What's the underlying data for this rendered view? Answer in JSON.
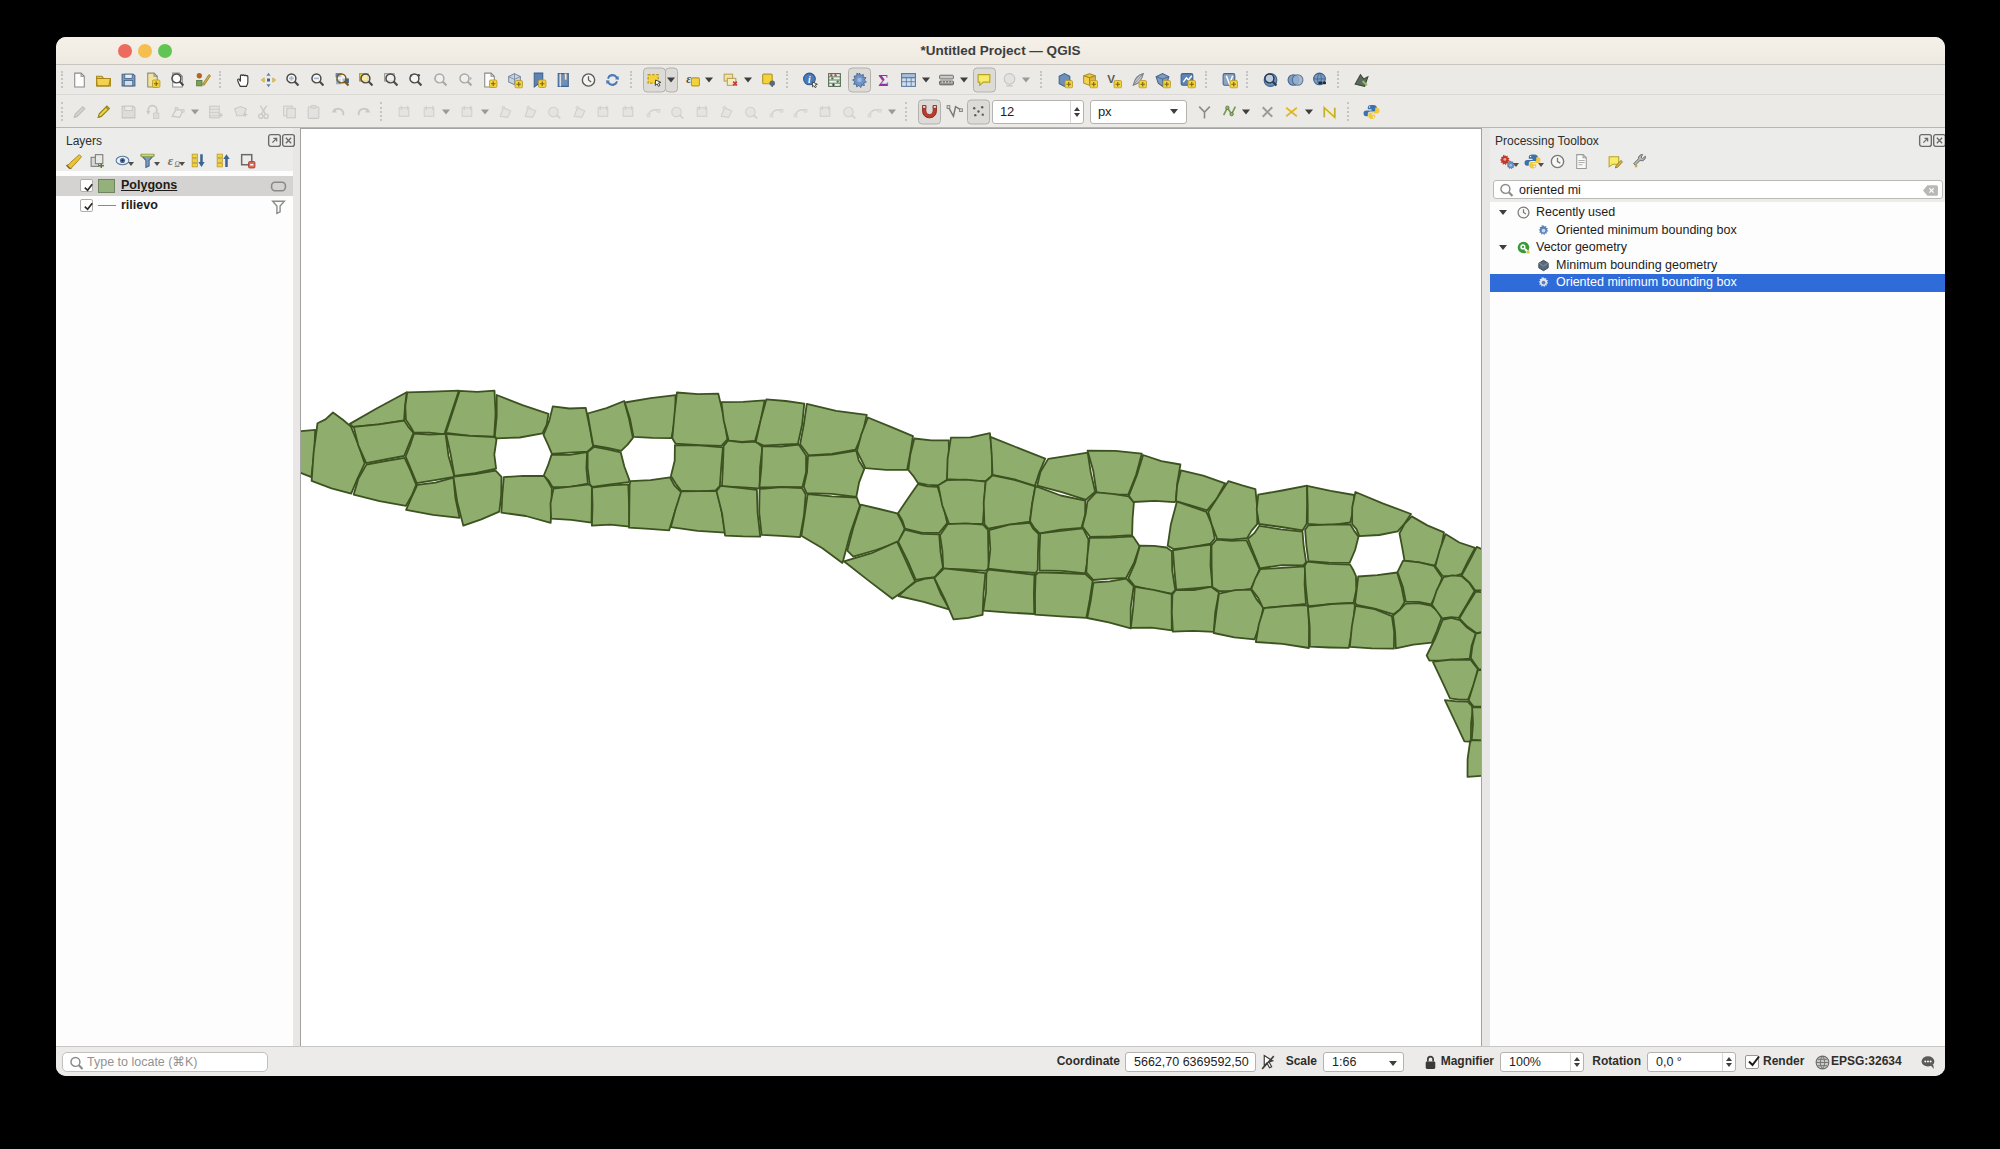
{
  "window": {
    "title": "*Untitled Project — QGIS"
  },
  "traffic_lights": {
    "close": "#ec6a5e",
    "minimize": "#f5bf4f",
    "zoom": "#61c554"
  },
  "toolbar_row1": [
    {
      "icon": "new-project"
    },
    {
      "icon": "open-project"
    },
    {
      "icon": "save-project"
    },
    {
      "icon": "save-as"
    },
    {
      "icon": "layout-manager"
    },
    {
      "icon": "style-manager"
    },
    {
      "sep": 1
    },
    {
      "icon": "pan-map"
    },
    {
      "icon": "pan-selection"
    },
    {
      "icon": "zoom-in"
    },
    {
      "icon": "zoom-out"
    },
    {
      "icon": "zoom-full"
    },
    {
      "icon": "zoom-selection"
    },
    {
      "icon": "zoom-layer"
    },
    {
      "icon": "zoom-native"
    },
    {
      "icon": "zoom-last",
      "disabled": 1
    },
    {
      "icon": "zoom-next",
      "disabled": 1
    },
    {
      "icon": "new-map-view"
    },
    {
      "icon": "new-3d-view"
    },
    {
      "icon": "new-bookmark"
    },
    {
      "icon": "show-bookmarks"
    },
    {
      "icon": "temporal-clock"
    },
    {
      "icon": "refresh"
    },
    {
      "sep": 1
    },
    {
      "icon": "select-rect",
      "pressed": 1,
      "dd": 1
    },
    {
      "icon": "select-expression",
      "dd": 1
    },
    {
      "icon": "deselect",
      "dd": 1
    },
    {
      "icon": "select-form"
    },
    {
      "sep": 1
    },
    {
      "icon": "identify"
    },
    {
      "icon": "stats-summary"
    },
    {
      "icon": "processing-gear",
      "pressed": 1
    },
    {
      "icon": "sigma"
    },
    {
      "icon": "attr-table",
      "dd": 1
    },
    {
      "icon": "measure",
      "dd": 1
    },
    {
      "icon": "map-tips",
      "pressed": 1
    },
    {
      "icon": "annotation",
      "disabled": 1,
      "dd": 1
    },
    {
      "sep": 1
    },
    {
      "icon": "new-geopackage"
    },
    {
      "icon": "new-shapefile"
    },
    {
      "icon": "new-virtual"
    },
    {
      "icon": "new-memory"
    },
    {
      "icon": "new-mesh"
    },
    {
      "icon": "new-gpx"
    },
    {
      "sep": 1
    },
    {
      "icon": "new-vrt"
    },
    {
      "sep": 1
    },
    {
      "icon": "metasearch"
    },
    {
      "icon": "datasource-manager"
    },
    {
      "icon": "web-services"
    },
    {
      "sep": 1
    },
    {
      "icon": "osm-plugin"
    }
  ],
  "toolbar_row2": [
    {
      "icon": "current-edits",
      "disabled": 1
    },
    {
      "icon": "toggle-editing"
    },
    {
      "icon": "save-edits",
      "disabled": 1
    },
    {
      "icon": "undo-edits",
      "disabled": 1
    },
    {
      "icon": "vertex-tool",
      "disabled": 1,
      "dd": 1
    },
    {
      "icon": "add-record",
      "disabled": 1
    },
    {
      "icon": "add-feature",
      "disabled": 1
    },
    {
      "icon": "cut-features",
      "disabled": 1
    },
    {
      "icon": "copy-features",
      "disabled": 1
    },
    {
      "icon": "paste-features",
      "disabled": 1
    },
    {
      "icon": "undo",
      "disabled": 1
    },
    {
      "icon": "redo",
      "disabled": 1
    },
    {
      "sep": 1
    },
    {
      "icon": "dig-chart",
      "disabled": 1
    },
    {
      "icon": "dig-line",
      "disabled": 1,
      "dd": 1
    },
    {
      "icon": "dig-circle",
      "disabled": 1,
      "dd": 1
    },
    {
      "icon": "dig-move",
      "disabled": 1
    },
    {
      "icon": "dig-copy",
      "disabled": 1
    },
    {
      "icon": "dig-rotate",
      "disabled": 1
    },
    {
      "icon": "dig-simplify",
      "disabled": 1
    },
    {
      "icon": "dig-add-ring",
      "disabled": 1
    },
    {
      "icon": "dig-fill-ring",
      "disabled": 1
    },
    {
      "icon": "dig-del-ring",
      "disabled": 1
    },
    {
      "icon": "dig-offset",
      "disabled": 1
    },
    {
      "icon": "dig-reshape",
      "disabled": 1
    },
    {
      "icon": "dig-split-feat",
      "disabled": 1
    },
    {
      "icon": "dig-split-parts",
      "disabled": 1
    },
    {
      "icon": "dig-merge",
      "disabled": 1
    },
    {
      "icon": "dig-merge-attr",
      "disabled": 1
    },
    {
      "icon": "dig-rotate-pt",
      "disabled": 1
    },
    {
      "icon": "dig-align",
      "disabled": 1
    },
    {
      "icon": "dig-trim",
      "disabled": 1,
      "dd": 1
    },
    {
      "sep": 1
    },
    {
      "icon": "snapping-magnet",
      "pressed": 1
    },
    {
      "icon": "topo-editing"
    },
    {
      "icon": "snap-intersection",
      "pressed": 1
    },
    {
      "type": "spin",
      "value": "12",
      "w": 92
    },
    {
      "type": "combo",
      "value": "px",
      "w": 97
    },
    {
      "icon": "tracing-y"
    },
    {
      "icon": "tracing-enable",
      "dd": 1
    },
    {
      "icon": "clear-x"
    },
    {
      "icon": "snap-yellow-x",
      "dd": 1
    },
    {
      "icon": "tracing-n"
    },
    {
      "sep": 1
    },
    {
      "icon": "python-console"
    }
  ],
  "layers_panel": {
    "title": "Layers",
    "toolbar": [
      {
        "icon": "style-brush"
      },
      {
        "icon": "add-group"
      },
      {
        "icon": "manage-themes",
        "dd": 1
      },
      {
        "icon": "filter-legend",
        "dd": 1
      },
      {
        "icon": "filter-expression",
        "dd": 1
      },
      {
        "icon": "expand-all"
      },
      {
        "icon": "collapse-all"
      },
      {
        "icon": "remove-layer"
      }
    ],
    "layers": [
      {
        "name": "Polygons",
        "checked": true,
        "selected": true,
        "active": true,
        "swatch": "#94b17c",
        "badge": "badge-map"
      },
      {
        "name": "rilievo",
        "checked": true,
        "symbol": "line",
        "badge": "badge-filter"
      }
    ]
  },
  "processing_panel": {
    "title": "Processing Toolbox",
    "toolbar": [
      {
        "icon": "proc-algs",
        "dd2": 1
      },
      {
        "icon": "python-console",
        "dd2": 1
      },
      {
        "icon": "history-clock"
      },
      {
        "icon": "log-doc"
      },
      {
        "sep": 1
      },
      {
        "icon": "edit-inplace"
      },
      {
        "icon": "wrench"
      }
    ],
    "search": {
      "value": "oriented mi"
    },
    "tree": [
      {
        "level": 0,
        "icon": "history-clock",
        "label": "Recently used",
        "expanded": true
      },
      {
        "level": 1,
        "icon": "algorithm",
        "label": "Oriented minimum bounding box"
      },
      {
        "level": 0,
        "icon": "qgis-logo",
        "label": "Vector geometry",
        "expanded": true
      },
      {
        "level": 1,
        "icon": "min-bounding",
        "label": "Minimum bounding geometry"
      },
      {
        "level": 1,
        "icon": "algorithm",
        "label": "Oriented minimum bounding box",
        "selected": true
      }
    ]
  },
  "statusbar": {
    "locate_placeholder": "Type to locate (⌘K)",
    "coordinate_label": "Coordinate",
    "coordinate_value": "5662,70 6369592,50",
    "scale_label": "Scale",
    "scale_value": "1:66",
    "magnifier_label": "Magnifier",
    "magnifier_value": "100%",
    "rotation_label": "Rotation",
    "rotation_value": "0,0 °",
    "render_label": "Render",
    "crs_label": "EPSG:32634"
  },
  "map": {
    "background": "#ffffff",
    "fill": "#8fad6c",
    "stroke": "#3c5220",
    "polygons": [
      "M267.6,457.7L271.2,445.2L273.2,432.0L294.1,430.7L314.2,428.9L313.3,452.2L310.4,476.1L289.0,467.5Z",
      "M332.0,411.5L341.9,418.7L350.0,425.6L357.5,444.1L363.7,462.4L356.6,477.4L350.2,492.7L330.5,487.4L310.6,479.9L312.6,451.6L316.5,422.2L324.5,418.4Z",
      "M405.7,391.3L404.0,405.6L403.1,419.4L377.8,423.4L352.1,426.0L348.8,422.9L376.5,407.0Z",
      "M352.7,425.9L378.0,423.3L403.2,419.6L407.8,426.4L412.5,431.9L407.7,443.9L403.1,455.0L384.3,458.4L365.2,462.2L357.3,444.4Z",
      "M352.7,493.6L357.4,477.5L365.4,463.6L384.4,460.0L403.6,456.9L409.6,469.9L415.2,483.8L410.8,494.5L404.9,504.9L378.5,500.1Z",
      "M444.4,433.3L428.4,431.6L412.6,431.3L409.4,425.4L404.9,418.8L404.3,405.3L406.2,391.3L431.6,390.7L457.8,389.7L450.6,411.6L443.4,433.1Z",
      "M451.5,476.2L434.1,479.2L415.7,482.2L410.5,469.5L404.6,455.5L409.0,444.5L413.0,432.5L428.4,433.5L444.6,432.9L447.5,454.9L453.7,476.4Z",
      "M405.1,508.9L410.5,496.4L416.3,483.9L434.4,481.6L452.5,476.7L454.4,497.0L458.6,516.9L431.9,513.8Z",
      "M444.8,432.0L451.6,411.1L458.7,389.8L476.3,390.8L493.5,389.7L494.6,412.6L493.2,435.6L469.1,434.8Z",
      "M453.4,475.0L449.8,454.3L445.3,434.0L444.7,432.9L469.1,434.8L494.1,436.1L495.5,438.6L493.3,453.5L495.1,467.6L474.1,472.2Z",
      "M453.1,475.6L474.2,473.0L494.6,469.5L500.5,475.8L500.2,494.1L498.3,510.7L480.3,518.3L462.3,524.6L456.2,500.8L452.5,476.3Z",
      "M493.8,435.0L495.7,415.3L495.7,394.0L521.5,404.1L547.5,412.8L545.8,423.3L541.5,432.4L518.7,436.5L495.3,437.4Z",
      "M502.8,476.1L522.4,474.8L543.4,475.0L547.3,480.7L550.9,487.4L550.4,504.4L549.7,521.8L524.8,515.0L500.4,511.6L501.3,493.9Z",
      "M550.9,452.8L546.9,443.4L542.5,433.8L548.3,419.6L551.8,405.4L568.4,407.5L584.7,406.8L588.6,425.8L592.2,445.4L586.5,450.7L568.5,451.7Z",
      "M542.8,474.5L547.1,464.2L550.5,453.9L568.6,453.9L586.1,451.2L585.4,467.2L586.9,482.7L569.7,485.8L551.6,486.2L548.0,480.2Z",
      "M588.2,483.4L590.9,485.9L590.8,504.2L590.5,521.7L570.2,518.9L550.1,517.6L549.5,502.6L552.4,487.7L569.8,485.6Z",
      "M620.1,449.8L606.7,447.0L592.2,444.5L589.3,428.1L586.6,412.5L605.5,407.2L623.2,400.0L628.1,418.1L631.9,436.9L626.6,443.6Z",
      "M628.6,479.6L627.6,481.1L609.3,483.4L591.5,485.8L588.7,483.3L586.6,467.1L586.6,451.0L593.1,445.9L606.5,448.4L619.7,451.3L623.4,465.7Z",
      "M590.9,524.6L591.5,505.0L591.0,486.7L609.4,484.3L627.3,483.3L628.1,504.3L628.7,525.7L609.3,523.7Z",
      "M670.5,437.2L651.8,436.9L632.5,435.9L629.1,418.3L623.8,401.5L649.7,397.1L674.5,394.2L674.4,415.6Z",
      "M669.0,476.3L673.3,484.3L680.6,491.5L674.0,510.4L668.2,529.3L648.2,527.8L628.0,526.7L628.3,505.0L628.6,483.5L629.6,480.1L649.5,479.2Z",
      "M671.3,437.2L673.3,414.8L675.9,391.5L697.0,393.1L717.3,392.6L722.8,416.1L726.4,438.4L720.5,444.9L698.0,444.2L674.6,442.7Z",
      "M722.0,446.3L720.3,465.1L718.9,484.8L714.7,489.3L698.3,490.7L680.1,489.7L675.0,483.1L669.9,475.1L673.7,459.7L673.9,444.2L698.1,444.4Z",
      "M669.8,526.2L674.4,508.7L680.2,490.4L698.2,490.1L716.3,489.9L720.7,510.6L724.3,531.7L696.6,529.9Z",
      "M763.7,399.4L759.5,420.2L754.0,440.0L740.7,440.9L727.7,439.6L722.8,419.9L720.4,401.2L742.0,400.8Z",
      "M757.2,487.3L738.8,486.2L720.9,485.3L721.9,464.9L722.6,444.9L727.0,439.6L740.8,441.3L755.1,440.5L761.4,446.1L759.1,466.0L758.6,487.3Z",
      "M724.1,534.7L721.0,512.1L715.5,490.2L719.6,484.8L738.6,486.9L755.9,488.9L756.6,512.1L759.3,535.6L742.2,535.4Z",
      "M762.7,444.6L754.8,441.1L759.7,418.9L765.3,398.4L784.7,400.0L803.3,402.6L801.2,423.2L796.9,443.0L779.7,443.7Z",
      "M758.4,486.3L760.4,466.1L761.2,445.0L779.9,445.5L797.8,443.5L805.1,454.6L805.1,471.0L801.5,485.9L780.5,486.2Z",
      "M760.6,533.9L758.2,511.7L758.6,488.9L759.0,487.9L780.4,486.0L801.0,487.0L804.7,493.4L803.0,514.5L799.1,536.1L779.5,534.9Z",
      "M865.8,413.8L861.6,432.3L854.6,448.6L830.9,452.8L807.5,454.3L799.1,443.2L802.8,423.7L805.8,402.8L835.1,409.9Z",
      "M805.6,492.1L802.7,485.7L806.0,471.3L807.0,454.9L831.0,453.7L855.3,449.6L857.8,459.5L863.2,468.1L858.1,481.4L855.3,495.9L831.0,492.8Z",
      "M800.3,534.8L803.6,514.3L806.6,493.0L830.9,495.3L855.8,496.5L858.9,504.8L849.5,531.7L842.3,559.1L841.4,561.9L821.1,547.1Z",
      "M906.1,468.8L885.1,468.8L864.4,467.1L860.1,458.3L855.9,449.9L860.4,433.1L866.9,416.5L889.2,425.6L912.0,435.1L909.2,452.6Z",
      "M859.8,503.6L878.3,508.0L896.2,512.3L900.5,520.3L903.7,528.0L897.3,541.2L874.9,549.0L852.3,555.6L846.3,549.6L852.2,526.9Z",
      "M842.9,560.3L870.5,552.2L896.1,540.6L905.3,560.7L914.1,580.4L903.0,589.7L891.4,597.8L867.6,579.6Z",
      "M916.9,482.0L912.4,475.1L907.3,469.0L909.3,453.5L913.3,437.5L930.4,439.4L947.8,439.4L948.0,458.7L946.0,478.7L937.7,484.3L926.5,483.9Z",
      "M938.2,531.9L921.1,531.9L904.0,527.6L901.4,519.8L897.0,512.2L907.1,497.2L917.0,483.1L926.3,485.4L936.7,485.9L942.2,504.0L946.2,522.1Z",
      "M933.7,576.1L923.5,577.3L914.8,578.9L906.8,560.1L897.1,540.7L903.7,528.7L921.1,532.8L938.2,533.4L939.5,550.5L942.0,566.7Z",
      "M897.4,595.0L905.4,587.8L914.6,580.7L923.4,577.8L933.1,576.6L939.9,593.1L948.7,608.7L922.7,600.9Z",
      "M984.6,480.2L965.2,479.4L946.0,478.2L946.6,457.6L949.9,436.7L969.4,436.3L988.9,432.2L991.3,453.0L991.1,474.3Z",
      "M937.3,484.3L946.4,479.0L965.0,478.6L984.6,480.6L983.3,501.5L981.9,522.9L964.7,522.9L948.1,523.0L941.2,504.2Z",
      "M942.2,567.7L941.4,550.2L939.0,534.3L946.8,523.1L964.8,522.4L982.1,523.7L987.0,529.0L987.3,548.2L987.7,567.4L984.5,569.8L963.4,568.5Z",
      "M943.1,567.4L963.2,569.5L984.4,572.1L982.6,592.3L981.6,613.9L967.5,616.9L952.5,618.4L943.3,597.1L933.3,576.9Z",
      "M1033.8,484.9L1013.5,478.4L991.5,473.8L990.8,455.1L989.4,435.9L1017.6,447.1L1044.2,457.7L1038.5,470.8L1033.7,485.6Z",
      "M1028.9,520.7L1008.1,523.6L987.2,527.7L983.4,523.3L982.7,501.5L984.7,480.6L991.6,474.3L1013.2,478.8L1034.3,485.5L1031.1,502.9Z",
      "M987.2,567.7L989.3,548.3L988.1,529.2L1008.3,523.6L1028.9,521.8L1032.1,527.6L1037.7,533.1L1037.0,551.3L1036.7,568.9L1034.6,572.0L1011.0,570.5Z",
      "M985.4,572.0L987.2,568.6L1010.7,571.0L1033.5,573.9L1032.9,592.9L1033.3,613.0L1008.1,611.6L982.3,609.7L985.0,590.8Z",
      "M1036.1,484.7L1039.5,470.7L1047.2,457.9L1066.5,454.8L1086.7,451.6L1089.7,471.1L1094.2,490.8L1085.0,498.8L1060.8,491.1Z",
      "M1035.9,485.6L1059.7,494.5L1084.3,499.6L1084.2,513.4L1080.5,526.9L1059.5,528.7L1038.7,532.5L1033.0,526.6L1029.0,520.2L1031.2,502.9L1034.2,486.3Z",
      "M1084.2,572.3L1061.0,569.8L1038.6,569.5L1038.4,551.3L1039.2,532.3L1059.9,529.9L1082.0,527.4L1087.4,538.0L1087.3,554.6Z",
      "M1091.7,579.8L1088.7,598.9L1085.4,616.9L1059.7,615.3L1034.1,613.6L1034.0,593.1L1034.6,574.0L1037.7,571.3L1060.8,572.0L1084.4,573.0Z",
      "M1127.3,493.6L1111.5,493.7L1095.5,491.3L1092.3,470.1L1086.5,449.6L1114.4,449.8L1140.8,452.7L1135.2,473.5Z",
      "M1089.2,536.0L1081.4,525.6L1084.6,513.3L1086.4,500.7L1095.1,491.3L1111.5,492.9L1127.6,495.4L1132.9,501.5L1131.6,517.3L1131.1,534.1L1109.9,535.3Z",
      "M1125.1,577.0L1108.7,577.7L1092.4,579.0L1085.3,571.4L1086.4,554.6L1088.5,536.9L1110.1,536.6L1131.9,535.3L1138.6,545.3L1133.2,561.4Z",
      "M1086.2,617.0L1089.8,599.2L1092.4,581.5L1108.9,580.4L1125.2,577.7L1132.7,585.4L1129.7,606.7L1129.8,627.4L1107.7,621.4Z",
      "M1173.4,501.2L1153.7,499.9L1132.4,501.0L1127.8,494.7L1135.8,474.4L1142.1,454.0L1160.4,460.2L1179.4,463.5L1176.3,482.2L1174.8,500.1Z",
      "M1133.6,585.0L1127.3,577.4L1134.2,561.6L1138.9,544.6L1153.0,544.8L1165.6,546.5L1170.9,550.2L1171.2,569.3L1174.3,589.1L1170.5,593.0L1152.4,589.6Z",
      "M1129.8,626.9L1132.2,606.3L1133.9,585.9L1152.6,588.9L1170.7,593.0L1170.7,611.3L1170.8,629.3L1150.5,626.6Z",
      "M1224.1,482.4L1216.0,497.3L1206.1,509.4L1190.5,504.7L1174.9,500.1L1176.2,484.3L1180.0,469.3L1202.2,474.7Z",
      "M1166.7,544.7L1169.9,523.2L1175.6,501.8L1175.4,500.5L1190.3,505.6L1205.4,510.9L1211.0,523.8L1213.8,537.6L1209.6,542.6L1190.7,546.1L1172.4,548.1Z",
      "M1171.9,549.3L1190.6,546.0L1210.0,543.6L1209.5,564.7L1211.5,585.6L1192.9,587.3L1175.2,588.7L1173.4,569.2Z",
      "M1171.4,593.5L1174.9,588.8L1193.0,589.0L1210.1,585.8L1217.9,591.6L1214.2,611.6L1212.9,630.8L1191.9,629.9L1171.9,630.7L1170.8,611.9Z",
      "M1216.2,538.0L1210.8,523.9L1207.2,511.1L1217.2,495.4L1227.5,480.1L1241.2,484.4L1254.4,488.1L1256.2,506.1L1256.2,523.1L1250.4,529.9L1246.1,537.1L1230.6,538.7Z",
      "M1210.5,544.4L1215.6,538.5L1230.5,539.8L1245.4,539.2L1251.7,553.0L1258.4,568.2L1254.8,577.6L1249.9,588.0L1234.1,589.8L1218.4,590.2L1211.3,586.0L1210.6,564.7Z",
      "M1212.7,632.0L1215.2,611.8L1217.9,592.6L1234.1,589.1L1250.1,588.6L1255.4,598.1L1262.3,606.4L1259.0,623.3L1253.5,638.4L1233.3,636.3Z",
      "M1301.7,529.3L1280.2,526.0L1258.0,523.0L1255.7,508.7L1257.2,493.6L1281.1,489.5L1306.1,484.7L1306.1,504.2L1305.7,522.8Z",
      "M1302.5,564.4L1280.9,564.1L1258.8,567.3L1252.8,552.6L1246.9,537.9L1253.3,532.2L1258.2,524.9L1279.9,528.3L1301.5,530.6L1302.7,545.2L1305.1,561.0Z",
      "M1305.0,602.9L1283.8,605.1L1262.0,607.1L1257.2,596.9L1250.3,588.1L1254.2,577.5L1259.4,568.1L1280.9,566.9L1304.1,565.4L1303.6,583.7Z",
      "M1307.2,605.5L1308.1,626.0L1307.9,647.0L1281.6,642.9L1254.8,641.0L1257.8,623.6L1263.0,607.1L1284.0,605.2L1304.6,604.0Z",
      "M1306.7,522.8L1306.7,504.0L1306.1,484.8L1329.6,489.8L1353.2,494.0L1352.2,508.5L1349.3,521.5L1328.3,524.5Z",
      "M1307.5,560.1L1305.4,544.8L1304.1,528.7L1307.1,524.4L1328.2,523.5L1349.2,523.3L1353.1,529.6L1357.5,535.6L1354.1,549.0L1348.6,561.9L1327.6,561.7Z",
      "M1352.6,601.8L1329.9,603.2L1307.8,605.1L1306.5,602.8L1304.6,583.6L1303.7,564.7L1306.0,560.7L1327.5,562.8L1349.1,563.6L1352.4,569.3L1355.0,575.2L1355.3,588.6Z",
      "M1353.9,604.1L1351.9,625.8L1347.8,646.9L1328.4,646.5L1308.8,645.7L1308.7,625.8L1306.9,606.1L1330.0,603.0L1352.7,602.0Z",
      "M1351.1,523.1L1351.2,506.4L1354.4,491.0L1381.6,502.3L1410.0,513.0L1403.6,522.6L1396.7,530.4L1378.2,534.0L1358.3,535.1L1355.5,528.1Z",
      "M1354.1,601.5L1355.7,588.8L1357.2,575.5L1376.3,574.2L1396.2,571.5L1400.6,586.4L1403.5,601.2L1399.0,608.5L1392.6,613.3L1373.7,607.6L1355.4,603.8Z",
      "M1390.9,615.2L1393.2,631.0L1392.9,647.7L1370.9,647.3L1348.8,645.8L1350.9,625.2L1354.5,604.9L1373.7,608.2Z",
      "M1443.0,531.3L1439.8,548.8L1433.8,564.7L1418.1,561.5L1403.5,559.7L1401.0,545.3L1398.5,532.3L1403.6,522.9L1410.7,515.4L1426.3,524.4Z",
      "M1396.5,571.1L1402.1,559.7L1418.3,561.4L1433.1,564.9L1441.1,576.8L1436.6,589.9L1430.2,603.4L1417.4,600.9L1404.8,600.7L1401.9,586.0Z",
      "M1404.9,602.5L1417.4,602.2L1429.8,604.5L1436.4,609.8L1440.5,617.0L1435.9,629.8L1430.9,641.6L1412.4,643.6L1394.8,647.3L1394.1,631.2L1392.0,614.6L1399.2,608.5Z",
      "M1474.1,546.9L1466.8,560.5L1460.7,572.8L1451.5,575.8L1441.4,574.8L1434.3,565.3L1438.6,549.3L1444.5,533.1L1458.3,541.5Z",
      "M1431.0,603.7L1435.6,589.5L1442.5,576.1L1451.2,574.3L1460.5,575.1L1468.0,581.5L1473.6,590.0L1465.6,603.7L1457.9,616.8L1450.1,616.1L1441.3,617.5L1435.9,610.3Z",
      "M1441.6,618.8L1450.1,616.8L1459.0,619.1L1465.6,626.2L1474.9,632.4L1470.6,644.8L1468.7,657.7L1449.0,659.5L1428.4,659.7L1425.7,654.5L1434.6,636.5Z",
      "M1432.4,660.7L1450.8,658.5L1469.6,658.8L1476.9,668.3L1472.6,684.3L1467.0,698.7L1458.1,698.6L1449.0,697.4L1440.9,679.8L1432.0,661.1Z",
      "M1443.9,699.1L1455.5,700.4L1466.6,700.5L1472.1,706.5L1470.1,722.2L1469.9,738.7L1468.3,740.7L1463.4,740.4L1453.5,719.4Z",
      "M1502.0,590.7L1487.9,589.4L1474.0,589.3L1468.3,581.3L1460.6,574.5L1468.5,560.1L1475.8,545.9L1491.2,552.4L1507.7,559.0L1505.7,574.8Z",
      "M1500.7,591.1L1506.6,598.6L1504.9,611.3L1503.3,623.6L1489.6,629.0L1475.7,632.2L1466.3,625.6L1458.3,617.5L1466.4,603.9L1474.8,590.6L1488.0,591.8Z",
      "M1469.8,657.1L1471.4,645.0L1474.8,632.7L1489.7,629.6L1504.2,624.8L1503.7,625.8L1507.4,646.5L1510.9,668.1L1510.1,668.7L1493.7,667.2L1477.8,668.5Z",
      "M1476.9,668.9L1493.6,670.2L1510.0,668.9L1510.4,685.3L1512.0,702.2L1508.4,704.8L1489.8,706.1L1472.3,705.4L1467.6,699.4L1472.3,684.3Z",
      "M1471.1,706.0L1489.7,706.5L1508.1,706.1L1507.4,723.0L1507.8,740.2L1488.8,740.2L1470.7,739.0L1472.0,722.3Z",
      "M1470.3,739.2L1488.8,739.7L1507.8,741.4L1508.7,740.3L1508.4,758.1L1506.2,776.0L1486.6,774.3L1466.5,775.8L1466.6,758.2L1468.9,742.0Z"
    ]
  }
}
